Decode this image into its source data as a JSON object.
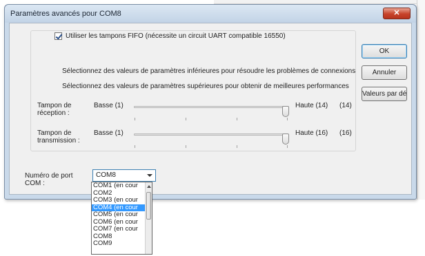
{
  "window": {
    "title": "Paramètres avancés pour COM8",
    "close_glyph": "✕"
  },
  "fifo": {
    "checked": true,
    "label": "Utiliser les tampons FIFO (nécessite un circuit UART compatible 16550)"
  },
  "descriptions": {
    "lower": "Sélectionnez des valeurs de paramètres inférieures pour résoudre les problèmes de connexions",
    "higher": "Sélectionnez des valeurs de paramètres supérieures pour obtenir de meilleures performances"
  },
  "receive": {
    "label": "Tampon de réception :",
    "low": "Basse (1)",
    "high": "Haute (14)",
    "value": "(14)",
    "level": 1.0
  },
  "transmit": {
    "label": "Tampon de transmission :",
    "low": "Basse (1)",
    "high": "Haute (16)",
    "value": "(16)",
    "level": 1.0
  },
  "buttons": {
    "ok": "OK",
    "cancel": "Annuler",
    "defaults": "Valeurs par défaut"
  },
  "port": {
    "label": "Numéro de port COM :",
    "selected": "COM8",
    "options": [
      "COM1 (en cour",
      "COM2",
      "COM3 (en cour",
      "COM4 (en cour",
      "COM5 (en cour",
      "COM6 (en cour",
      "COM7 (en cour",
      "COM8",
      "COM9"
    ],
    "highlighted_index": 3
  },
  "colors": {
    "selection": "#3399ff",
    "close_button": "#c7432a",
    "window_frame": "#c9d9ea"
  },
  "icons": {
    "close": "close-icon",
    "combo_arrow": "chevron-down-icon",
    "scroll_up": "chevron-up-icon"
  }
}
